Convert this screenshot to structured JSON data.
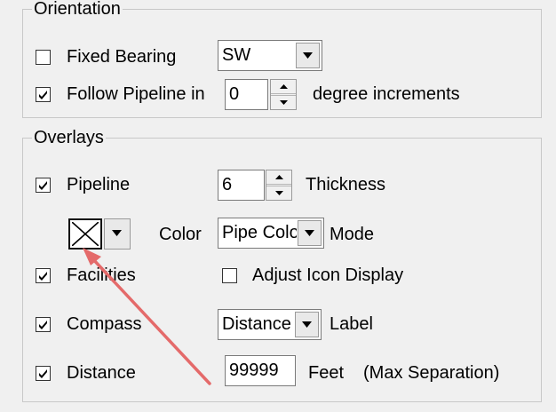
{
  "orientation": {
    "title": "Orientation",
    "fixed_bearing": {
      "label": "Fixed Bearing",
      "checked": false,
      "value": "SW"
    },
    "follow_pipeline": {
      "label": "Follow Pipeline in",
      "checked": true,
      "value": "0",
      "suffix": "degree increments"
    }
  },
  "overlays": {
    "title": "Overlays",
    "pipeline": {
      "label": "Pipeline",
      "checked": true,
      "value": "6",
      "suffix": "Thickness"
    },
    "color": {
      "label": "Color",
      "mode_value": "Pipe Color",
      "mode_suffix": "Mode"
    },
    "facilities": {
      "label": "Facilities",
      "checked": true,
      "adjust_label": "Adjust Icon Display",
      "adjust_checked": false
    },
    "compass": {
      "label": "Compass",
      "checked": true,
      "value": "Distance",
      "suffix": "Label"
    },
    "distance": {
      "label": "Distance",
      "checked": true,
      "value": "99999",
      "units": "Feet",
      "note": "(Max Separation)"
    }
  },
  "icons": {
    "check": "check-icon",
    "dropdown": "chevron-down-icon",
    "spin_up": "spin-up-icon",
    "spin_down": "spin-down-icon",
    "swatch": "color-swatch-icon"
  },
  "colors": {
    "annotation_arrow": "#e46a6a"
  }
}
